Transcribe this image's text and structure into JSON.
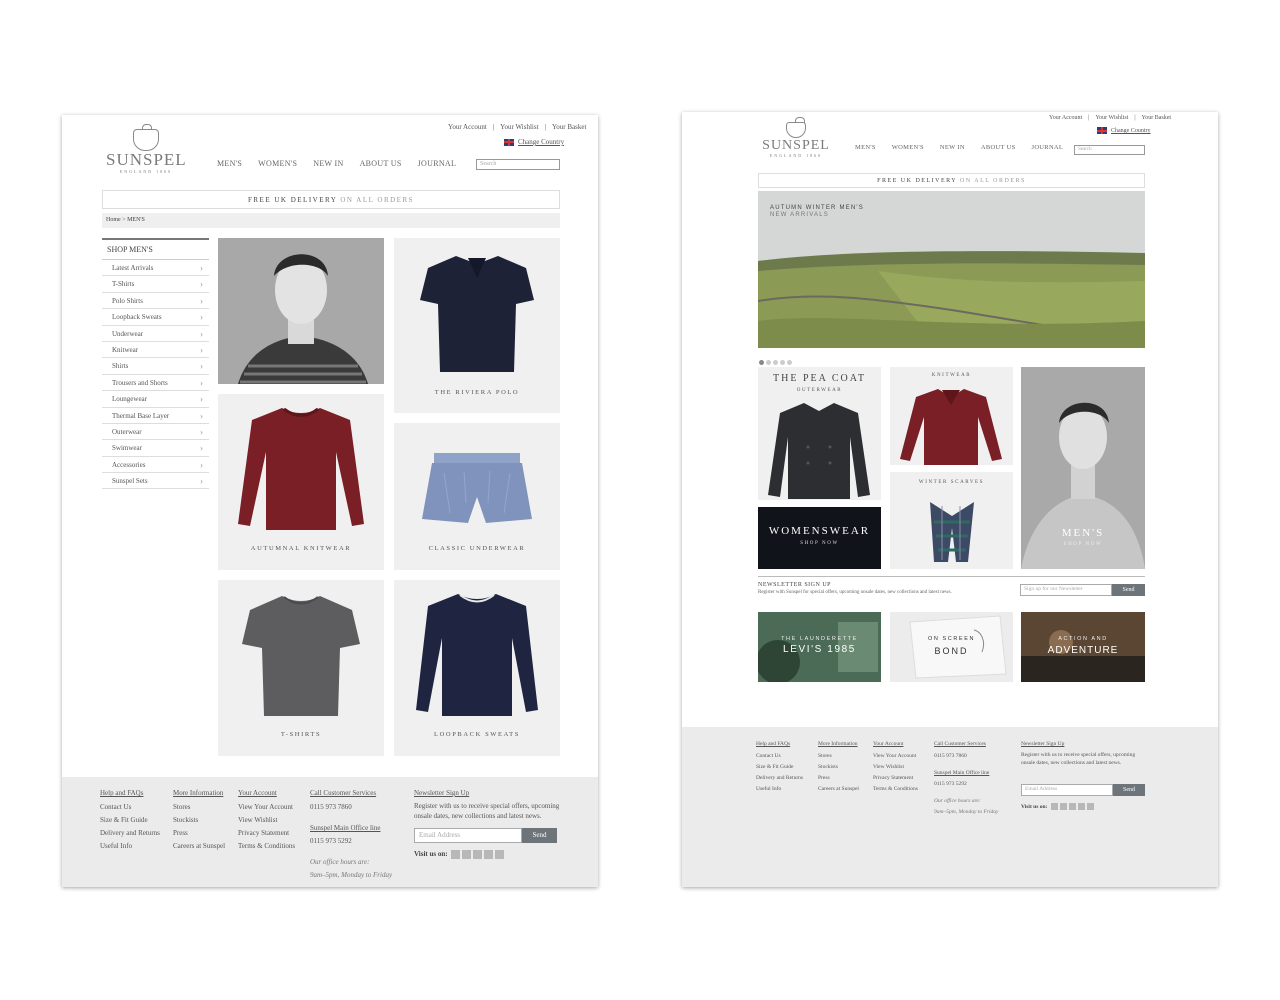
{
  "top_links": {
    "account": "Your Account",
    "wishlist": "Your Wishlist",
    "basket": "Your Basket",
    "sep": "|",
    "change_country": "Change Country"
  },
  "brand": {
    "name": "SUNSPEL",
    "tagline": "ENGLAND 1860"
  },
  "nav": {
    "mens": "MEN'S",
    "womens": "WOMEN'S",
    "new_in": "NEW IN",
    "about": "ABOUT US",
    "journal": "JOURNAL",
    "search_placeholder": "Search"
  },
  "delivery": {
    "bold": "FREE UK DELIVERY",
    "light": "ON ALL ORDERS"
  },
  "breadcrumb": {
    "home": "Home",
    "sep": ">",
    "current": "MEN'S"
  },
  "sidebar": {
    "title": "SHOP MEN'S",
    "items": [
      "Latest Arrivals",
      "T-Shirts",
      "Polo Shirts",
      "Loopback Sweats",
      "Underwear",
      "Knitwear",
      "Shirts",
      "Trousers and Shorts",
      "Loungewear",
      "Thermal Base Layer",
      "Outerwear",
      "Swimwear",
      "Accessories",
      "Sunspel Sets"
    ]
  },
  "mens_tiles": {
    "riviera": "THE RIVIERA POLO",
    "knitwear": "AUTUMNAL KNITWEAR",
    "underwear": "CLASSIC UNDERWEAR",
    "tshirts": "T-SHIRTS",
    "loopback": "LOOPBACK SWEATS"
  },
  "footer": {
    "help": {
      "title": "Help and FAQs",
      "links": [
        "Contact Us",
        "Size & Fit Guide",
        "Delivery and Returns",
        "Useful Info"
      ]
    },
    "more": {
      "title": "More Information",
      "links": [
        "Stores",
        "Stockists",
        "Press",
        "Careers at Sunspel"
      ]
    },
    "account": {
      "title": "Your Account",
      "links": [
        "View Your Account",
        "View Wishlist",
        "Privacy Statement",
        "Terms & Conditions"
      ]
    },
    "call": {
      "title": "Call Customer Services",
      "phone": "0115 973 7860",
      "office_title": "Sunspel Main Office line",
      "office_phone": "0115 973 5292",
      "hours1": "Our office hours are:",
      "hours2": "9am–5pm, Monday to Friday"
    },
    "newsletter": {
      "title": "Newsletter Sign Up",
      "text": "Register with us to receive special offers, upcoming onsale dates, new collections and latest news.",
      "placeholder": "Email Address",
      "send": "Send",
      "visit": "Visit us on:"
    }
  },
  "home": {
    "hero": {
      "line1": "AUTUMN WINTER MEN'S",
      "line2": "NEW ARRIVALS"
    },
    "pea_coat": {
      "title": "THE PEA COAT",
      "sub": "OUTERWEAR"
    },
    "knitwear": "KNITWEAR",
    "winter_scarves": "WINTER SCARVES",
    "womenswear": {
      "title": "WOMENSWEAR",
      "sub": "SHOP NOW"
    },
    "mens": {
      "title": "MEN'S",
      "sub": "SHOP NOW"
    },
    "newsletter": {
      "title": "NEWSLETTER SIGN UP",
      "text": "Register with Sunspel for special offers, upcoming onsale dates, new collections and latest news.",
      "placeholder": "Sign up for our Newsletter",
      "send": "Send"
    },
    "promo1": {
      "line1": "THE LAUNDERETTE",
      "line2": "LEVI'S 1985"
    },
    "promo2": {
      "line1": "ON SCREEN",
      "line2": "BOND"
    },
    "promo3": {
      "line1": "ACTION AND",
      "line2": "ADVENTURE"
    }
  },
  "colors": {
    "footer_bg": "#ebebeb",
    "button": "#6d747a",
    "burgundy": "#7a1f25",
    "navy": "#1e2236",
    "grey_tee": "#5d5d5f"
  }
}
